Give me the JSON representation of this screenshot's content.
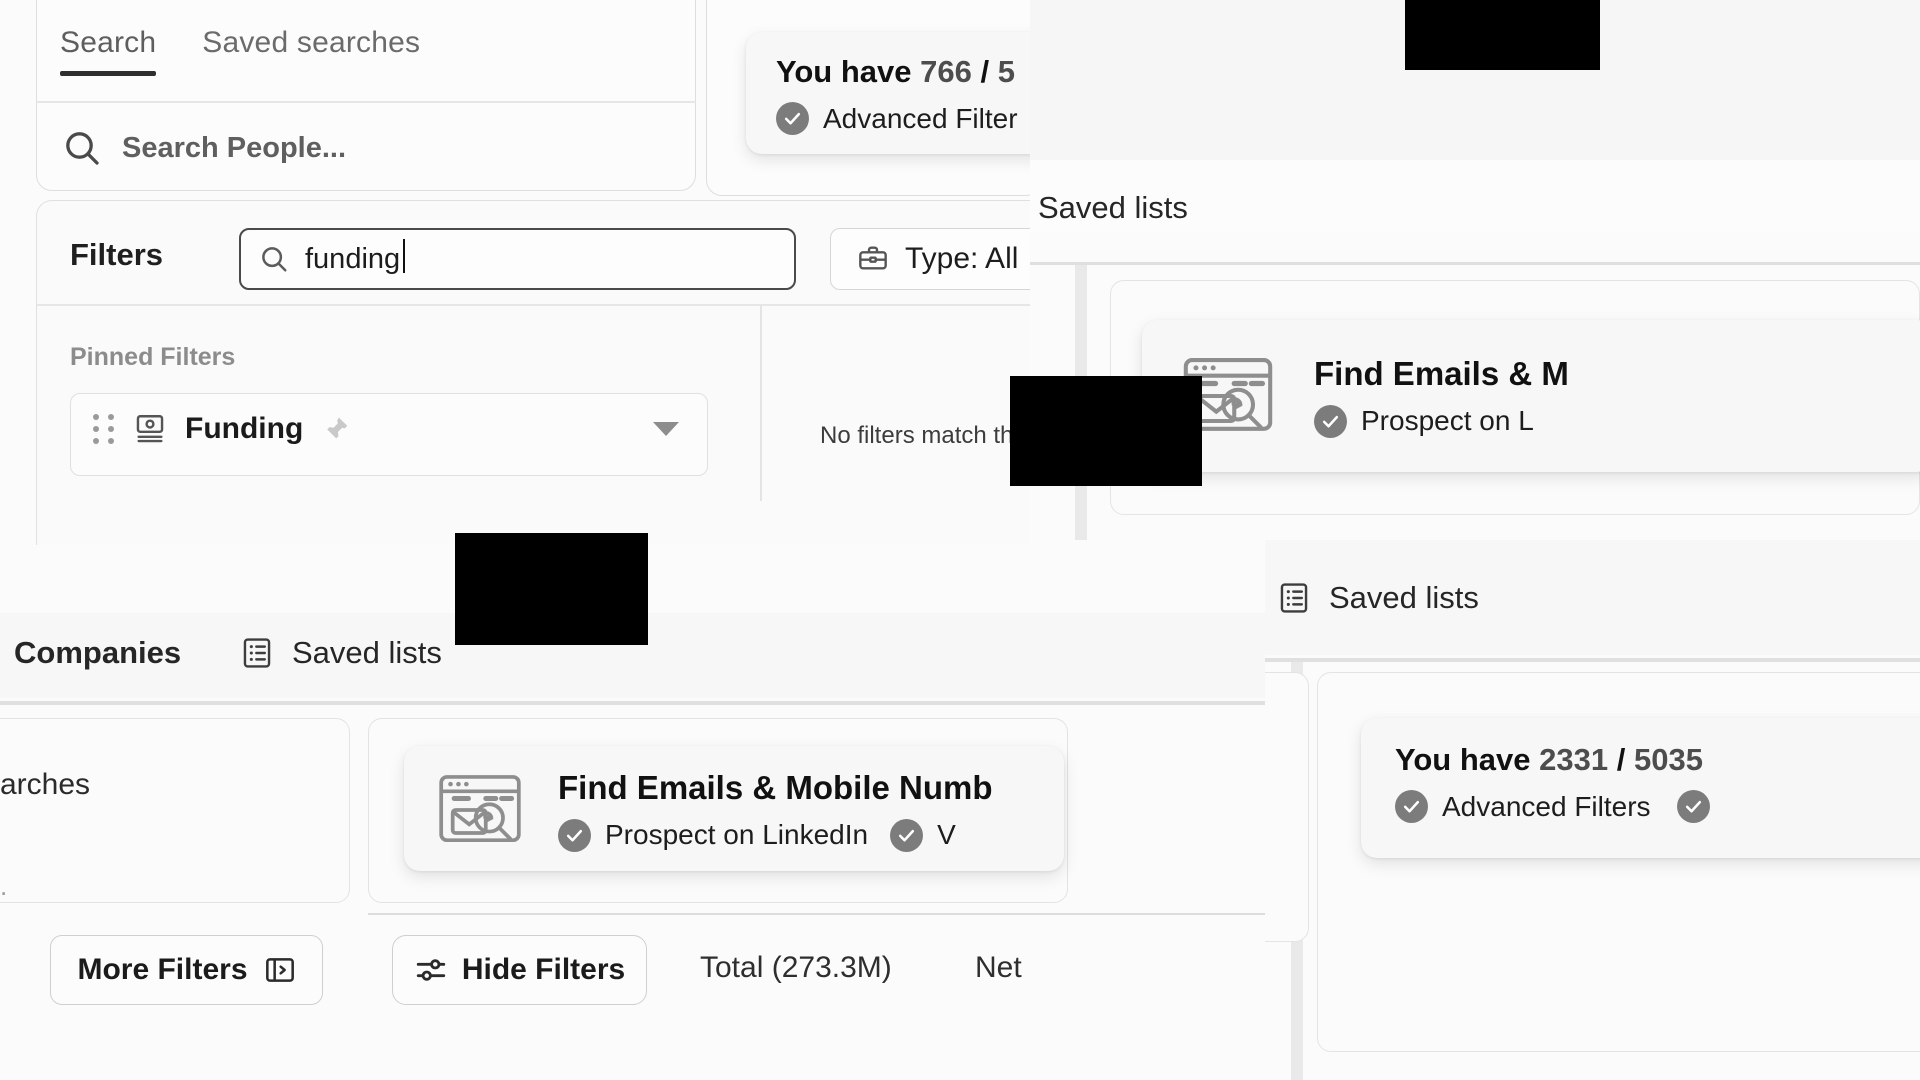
{
  "search_panel": {
    "tabs": [
      {
        "label": "Search",
        "active": true
      },
      {
        "label": "Saved searches",
        "active": false
      }
    ],
    "people_search": {
      "placeholder": "Search People...",
      "icon": "search-icon"
    }
  },
  "filters_panel": {
    "title": "Filters",
    "filter_search": {
      "value": "funding",
      "icon": "search-icon"
    },
    "type_chip": {
      "label": "Type: All",
      "icon": "briefcase-icon"
    },
    "pinned_section_label": "Pinned Filters",
    "pinned_filters": [
      {
        "label": "Funding",
        "icon": "funding-icon",
        "pin_icon": "pin-icon",
        "drag_icon": "drag-handle-icon",
        "expand_icon": "chevron-down-icon"
      }
    ],
    "empty_state": "No filters match th"
  },
  "credit_card_top": {
    "prefix": "You have",
    "used": "766",
    "separator": "/",
    "total_partial": "5",
    "features": [
      {
        "label": "Advanced Filter",
        "icon": "check-circle-icon"
      }
    ]
  },
  "credit_card_bottom": {
    "prefix": "You have",
    "used": "2331",
    "separator": "/",
    "total": "5035",
    "features": [
      {
        "label": "Advanced Filters",
        "icon": "check-circle-icon"
      },
      {
        "label": "",
        "icon": "check-circle-icon"
      }
    ]
  },
  "promo_card_right": {
    "title": "Find Emails & M",
    "icon": "browser-email-search-icon",
    "features": [
      {
        "label": "Prospect on L",
        "icon": "check-circle-icon"
      }
    ]
  },
  "promo_card_bottom": {
    "title": "Find Emails & Mobile Numb",
    "icon": "browser-email-search-icon",
    "features": [
      {
        "label": "Prospect on LinkedIn",
        "icon": "check-circle-icon"
      },
      {
        "label": "V",
        "icon": "check-circle-icon"
      }
    ]
  },
  "nav_strip": {
    "companies_tab": "Companies",
    "saved_lists_tab": "Saved lists",
    "saved_lists_icon": "list-icon"
  },
  "right_column": {
    "saved_lists_label": "Saved lists",
    "saved_lists_icon": "list-icon"
  },
  "bottom_right_column": {
    "saved_lists_label": "Saved lists",
    "saved_lists_icon": "list-icon"
  },
  "saved_searches_fragment": {
    "text": "arches",
    "dot": "."
  },
  "bottom_bar": {
    "more_filters": {
      "label": "More Filters",
      "icon": "panel-expand-icon"
    },
    "hide_filters": {
      "label": "Hide Filters",
      "icon": "sliders-icon"
    },
    "total_label": "Total (273.3M)",
    "net_label": "Net"
  },
  "colors": {
    "page_bg": "#fbfbfb",
    "card_bg": "#fcfcfc",
    "text_primary": "#1b1b1b",
    "text_muted": "#8c8c8c",
    "tick_gray": "#7c7c7c",
    "border": "#e0e0e0",
    "redaction": "#000000"
  }
}
